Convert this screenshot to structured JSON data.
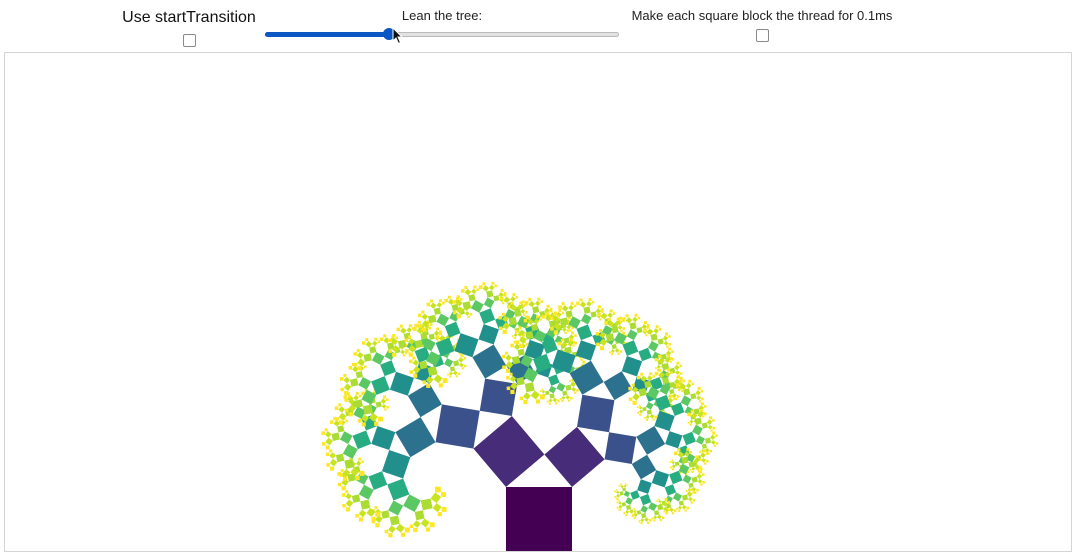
{
  "controls": {
    "transition_label": "Use startTransition",
    "transition_checked": false,
    "lean_label": "Lean the tree:",
    "lean_value": 0.35,
    "block_label": "Make each square block the thread for 0.1ms",
    "block_checked": false
  },
  "tree": {
    "depth": 10,
    "colors": [
      "#440154",
      "#472c7a",
      "#3b518b",
      "#2c718e",
      "#21908d",
      "#27ad81",
      "#5cc863",
      "#aadc32",
      "#c9e31f",
      "#fde725"
    ]
  }
}
